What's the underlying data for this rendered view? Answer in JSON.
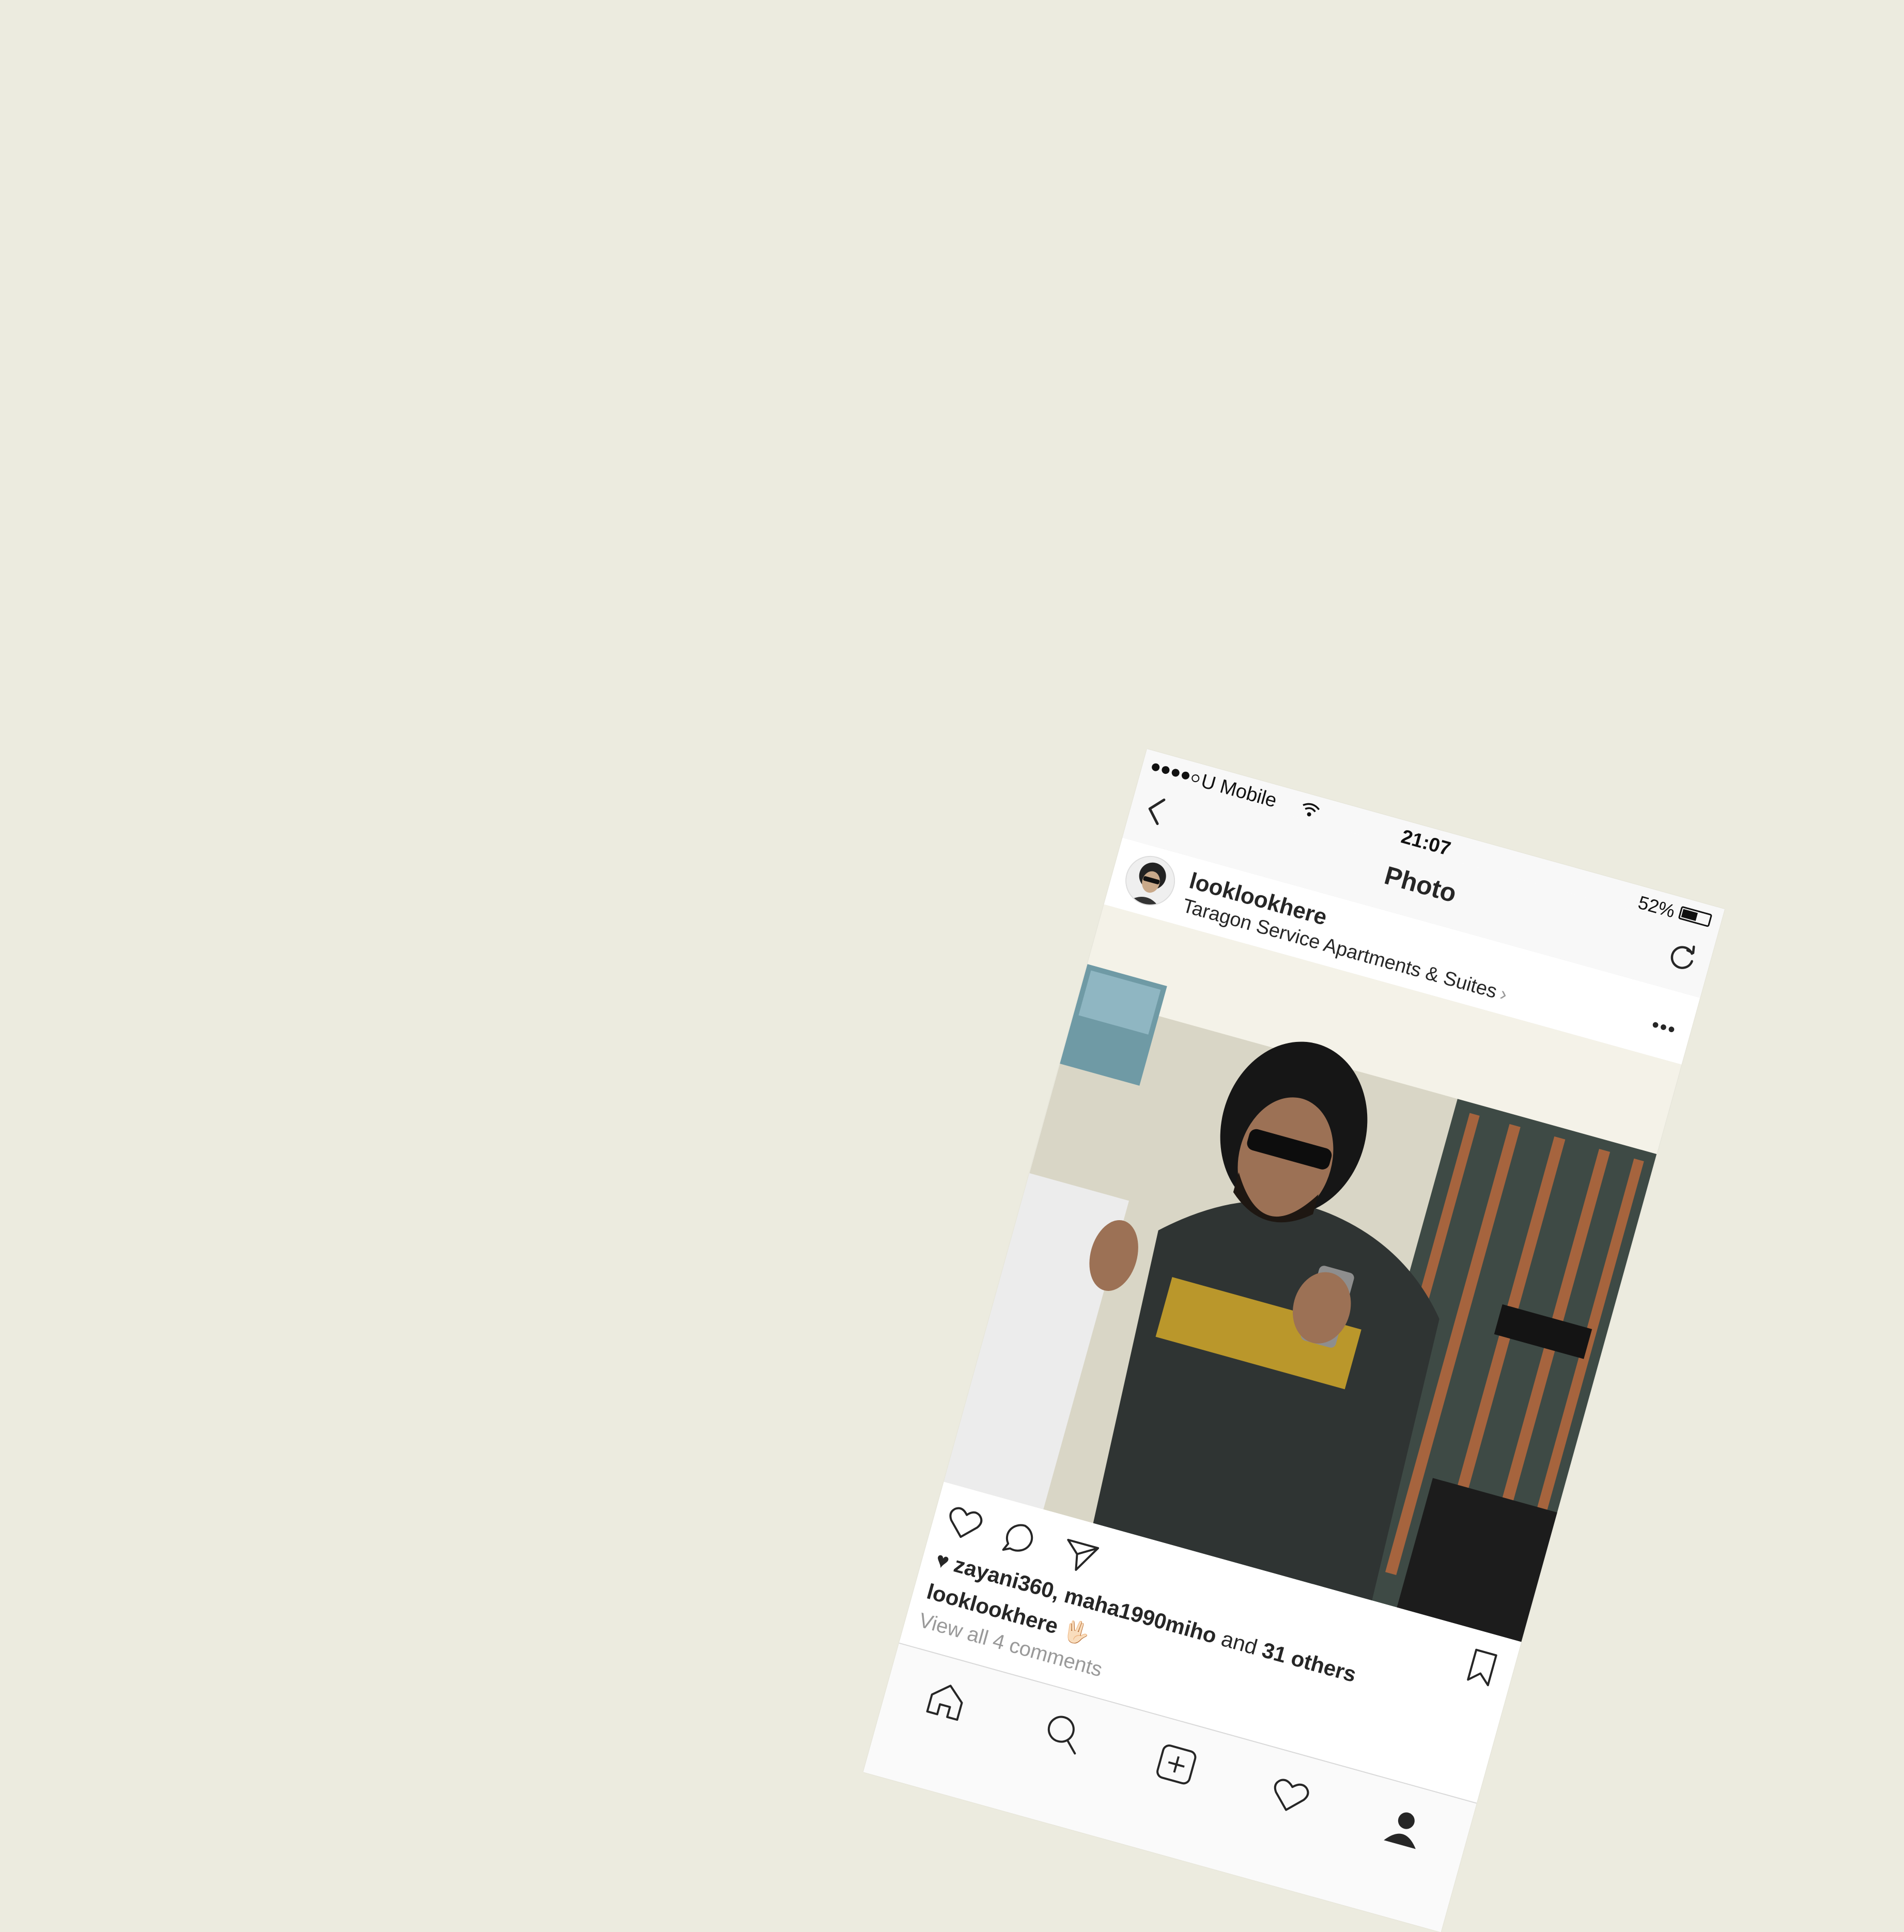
{
  "status_bar": {
    "carrier": "U Mobile",
    "time": "21:07",
    "battery": "52%",
    "signal_bars_filled": 4,
    "signal_bars_total": 5
  },
  "nav": {
    "title": "Photo"
  },
  "post": {
    "username": "looklookhere",
    "location": "Taragon Service Apartments & Suites",
    "likes": {
      "users": "zayani360, maha1990miho",
      "and_label": "and",
      "others": "31 others"
    },
    "caption_user": "looklookhere",
    "caption_emoji": "🖖🏻",
    "view_comments": "View all 4 comments"
  },
  "icons": [
    "back-icon",
    "refresh-icon",
    "more-icon",
    "like-icon",
    "comment-icon",
    "share-icon",
    "bookmark-icon",
    "home-icon",
    "search-icon",
    "add-icon",
    "activity-icon",
    "profile-icon"
  ]
}
